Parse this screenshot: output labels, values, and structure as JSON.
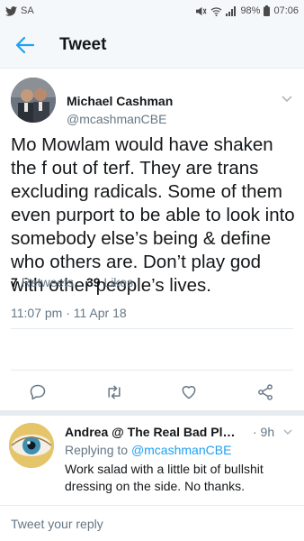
{
  "status_bar": {
    "carrier": "SA",
    "battery": "98%",
    "time": "07:06"
  },
  "app_bar": {
    "title": "Tweet"
  },
  "tweet": {
    "author_name": "Michael Cashman",
    "author_handle": "@mcashmanCBE",
    "text": "Mo Mowlam would have shaken the f out of terf. They are trans excluding radicals. Some of them even purport to be able to look into somebody else’s being & define who others are. Don’t play god with other people’s lives.",
    "timestamp": "11:07 pm · 11 Apr 18",
    "retweets_count": "7",
    "retweets_label": "Retweets",
    "likes_count": "39",
    "likes_label": "Likes"
  },
  "reply": {
    "author_name": "Andrea @ The Real Bad Place ...",
    "time": "· 9h",
    "replying_prefix": "Replying to",
    "replying_handle": "@mcashmanCBE",
    "text": "Work salad with a little bit of bullshit dressing on the side. No thanks."
  },
  "compose": {
    "placeholder": "Tweet your reply"
  },
  "colors": {
    "accent": "#1da1f2",
    "secondary_text": "#657786",
    "primary_text": "#14171a"
  }
}
